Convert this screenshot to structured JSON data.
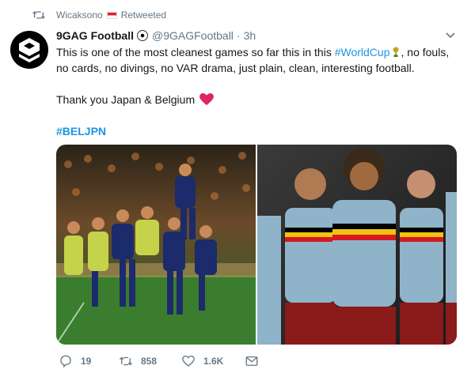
{
  "retweet_context": {
    "user": "Wicaksono",
    "label": "Retweeted"
  },
  "tweet": {
    "author_name": "9GAG Football",
    "author_handle": "@9GAGFootball",
    "separator": "·",
    "time": "3h",
    "text_part1": "This is one of the most cleanest games so far this in this ",
    "hashtag_worldcup": "#WorldCup",
    "text_part2": ", no fouls, no cards, no divings, no VAR drama, just plain, clean, interesting football.",
    "thanks_line": "Thank you Japan & Belgium",
    "hashtag_beljpn": "#BELJPN"
  },
  "actions": {
    "replies": "19",
    "retweets": "858",
    "likes": "1.6K"
  },
  "colors": {
    "link": "#1b95e0",
    "muted": "#657786",
    "heart": "#e0245e",
    "japan_blue": "#1c2b6b",
    "belgium_red": "#d71920"
  },
  "icons": [
    "retweet-icon",
    "japan-flag-icon",
    "9gag-logo",
    "soccer-ball-icon",
    "chevron-down-icon",
    "trophy-icon",
    "heart-emoji-icon",
    "reply-icon",
    "like-icon",
    "direct-message-icon"
  ]
}
